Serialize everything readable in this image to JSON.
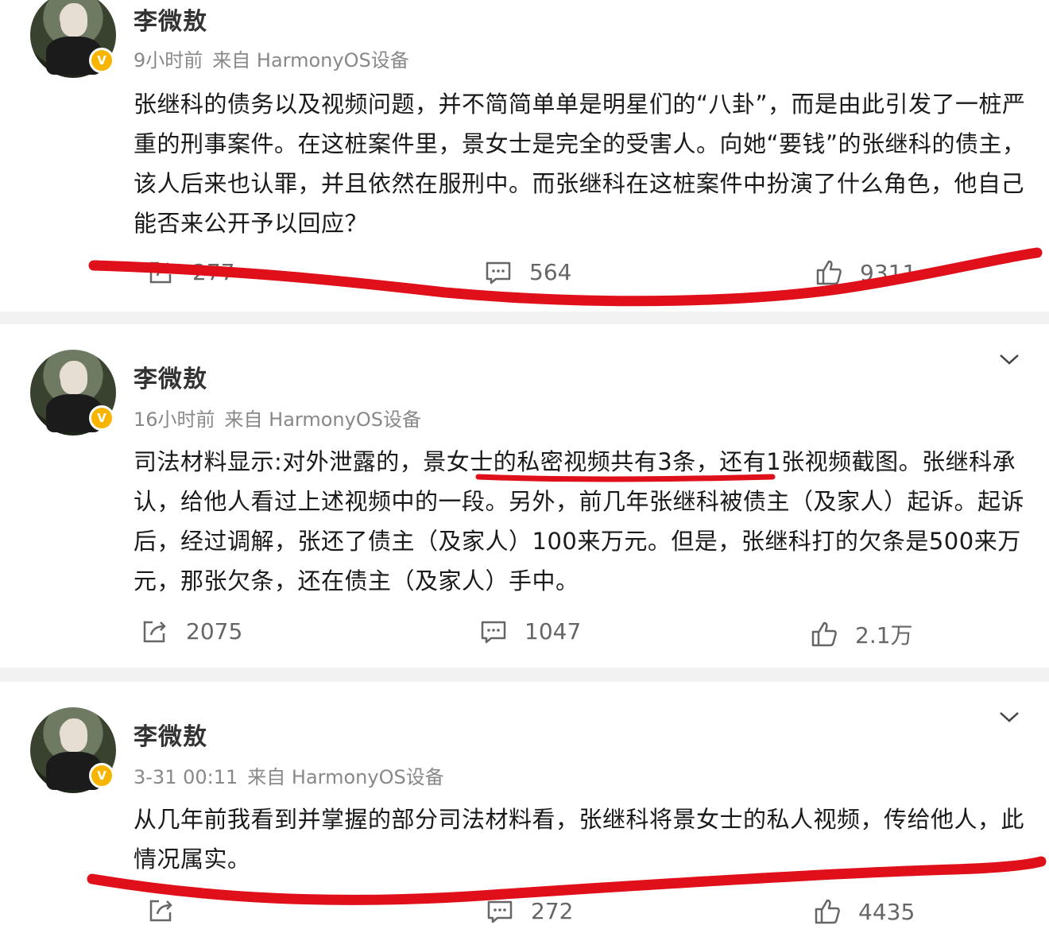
{
  "posts": [
    {
      "author": "李微敖",
      "time": "9小时前",
      "source": "来自 HarmonyOS设备",
      "text": "张继科的债务以及视频问题，并不简简单单是明星们的“八卦”，而是由此引发了一桩严重的刑事案件。在这桩案件里，景女士是完全的受害人。向她“要钱”的张继科的债主，该人后来也认罪，并且依然在服刑中。而张继科在这桩案件中扮演了什么角色，他自己能否来公开予以回应？",
      "reposts": "277",
      "comments": "564",
      "likes": "9311"
    },
    {
      "author": "李微敖",
      "time": "16小时前",
      "source": "来自 HarmonyOS设备",
      "text": "司法材料显示:对外泄露的，景女士的私密视频共有3条，还有1张视频截图。张继科承认，给他人看过上述视频中的一段。另外，前几年张继科被债主（及家人）起诉。起诉后，经过调解，张还了债主（及家人）100来万元。但是，张继科打的欠条是500来万元，那张欠条，还在债主（及家人）手中。",
      "reposts": "2075",
      "comments": "1047",
      "likes": "2.1万"
    },
    {
      "author": "李微敖",
      "time": "3-31 00:11",
      "source": "来自 HarmonyOS设备",
      "text": "从几年前我看到并掌握的部分司法材料看，张继科将景女士的私人视频，传给他人，此情况属实。",
      "reposts": "",
      "comments": "272",
      "likes": "4435"
    }
  ],
  "annotation_color": "#e0101a",
  "icons": [
    "repost-icon",
    "comment-icon",
    "like-icon",
    "chevron-down-icon",
    "verified-badge-icon"
  ]
}
